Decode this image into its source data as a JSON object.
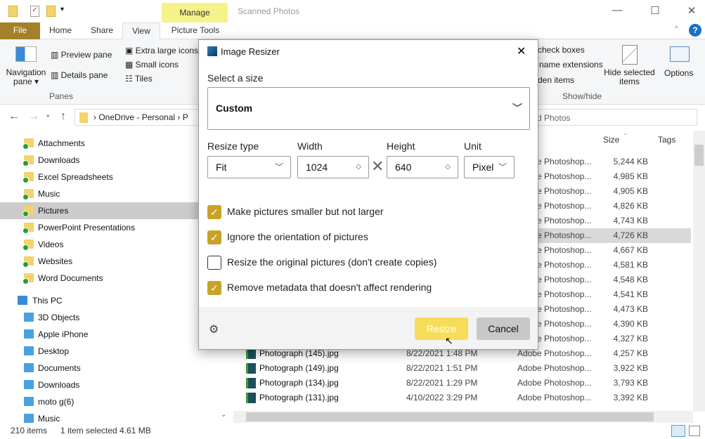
{
  "window": {
    "title": "Scanned Photos",
    "context_tab": "Manage",
    "minimize": "—",
    "maximize": "☐",
    "close": "✕"
  },
  "ribbon": {
    "tabs": [
      "File",
      "Home",
      "Share",
      "View",
      "Picture Tools"
    ],
    "navigation_pane": "Navigation pane ▾",
    "preview_pane": "Preview pane",
    "details_pane": "Details pane",
    "panes_group": "Panes",
    "layout": [
      "Extra large icons",
      "Small icons",
      "Tiles"
    ],
    "show_hide": [
      "check boxes",
      "name extensions",
      "den items"
    ],
    "hide_selected": "Hide selected items",
    "options": "Options",
    "show_hide_group": "Show/hide"
  },
  "address": {
    "path": [
      "OneDrive - Personal",
      "P"
    ],
    "search": "d Photos"
  },
  "sidebar": {
    "items": [
      {
        "label": "Attachments",
        "type": "folder"
      },
      {
        "label": "Downloads",
        "type": "folder"
      },
      {
        "label": "Excel Spreadsheets",
        "type": "folder"
      },
      {
        "label": "Music",
        "type": "folder"
      },
      {
        "label": "Pictures",
        "type": "folder",
        "selected": true
      },
      {
        "label": "PowerPoint Presentations",
        "type": "folder"
      },
      {
        "label": "Videos",
        "type": "folder"
      },
      {
        "label": "Websites",
        "type": "folder"
      },
      {
        "label": "Word Documents",
        "type": "folder"
      },
      {
        "label": "This PC",
        "type": "pc"
      },
      {
        "label": "3D Objects",
        "type": "dev"
      },
      {
        "label": "Apple iPhone",
        "type": "dev"
      },
      {
        "label": "Desktop",
        "type": "dev"
      },
      {
        "label": "Documents",
        "type": "dev"
      },
      {
        "label": "Downloads",
        "type": "dev"
      },
      {
        "label": "moto g(6)",
        "type": "dev"
      },
      {
        "label": "Music",
        "type": "dev"
      }
    ]
  },
  "files": {
    "columns": {
      "size": "Size",
      "tags": "Tags"
    },
    "rows": [
      {
        "name": "",
        "date": "",
        "type": "Adobe Photoshop...",
        "size": "5,244 KB"
      },
      {
        "name": "",
        "date": "",
        "type": "Adobe Photoshop...",
        "size": "4,985 KB"
      },
      {
        "name": "",
        "date": "",
        "type": "Adobe Photoshop...",
        "size": "4,905 KB"
      },
      {
        "name": "",
        "date": "",
        "type": "Adobe Photoshop...",
        "size": "4,826 KB"
      },
      {
        "name": "",
        "date": "",
        "type": "Adobe Photoshop...",
        "size": "4,743 KB"
      },
      {
        "name": "",
        "date": "",
        "type": "Adobe Photoshop...",
        "size": "4,726 KB",
        "selected": true
      },
      {
        "name": "",
        "date": "",
        "type": "Adobe Photoshop...",
        "size": "4,667 KB"
      },
      {
        "name": "",
        "date": "",
        "type": "Adobe Photoshop...",
        "size": "4,581 KB"
      },
      {
        "name": "",
        "date": "",
        "type": "Adobe Photoshop...",
        "size": "4,548 KB"
      },
      {
        "name": "",
        "date": "",
        "type": "Adobe Photoshop...",
        "size": "4,541 KB"
      },
      {
        "name": "",
        "date": "",
        "type": "Adobe Photoshop...",
        "size": "4,473 KB"
      },
      {
        "name": "",
        "date": "",
        "type": "Adobe Photoshop...",
        "size": "4,390 KB"
      },
      {
        "name": "",
        "date": "",
        "type": "Adobe Photoshop...",
        "size": "4,327 KB"
      },
      {
        "name": "Photograph (145).jpg",
        "date": "8/22/2021 1:48 PM",
        "type": "Adobe Photoshop...",
        "size": "4,257 KB"
      },
      {
        "name": "Photograph (149).jpg",
        "date": "8/22/2021 1:51 PM",
        "type": "Adobe Photoshop...",
        "size": "3,922 KB"
      },
      {
        "name": "Photograph (134).jpg",
        "date": "8/22/2021 1:29 PM",
        "type": "Adobe Photoshop...",
        "size": "3,793 KB"
      },
      {
        "name": "Photograph (131).jpg",
        "date": "4/10/2022 3:29 PM",
        "type": "Adobe Photoshop...",
        "size": "3,392 KB"
      }
    ]
  },
  "status": {
    "count": "210 items",
    "selection": "1 item selected  4.61 MB"
  },
  "dialog": {
    "title": "Image Resizer",
    "close": "✕",
    "select_size_label": "Select a size",
    "size_value": "Custom",
    "resize_type_label": "Resize type",
    "resize_type_value": "Fit",
    "width_label": "Width",
    "width_value": "1024",
    "height_label": "Height",
    "height_value": "640",
    "unit_label": "Unit",
    "unit_value": "Pixel",
    "options": [
      {
        "label": "Make pictures smaller but not larger",
        "checked": true
      },
      {
        "label": "Ignore the orientation of pictures",
        "checked": true
      },
      {
        "label": "Resize the original pictures (don't create copies)",
        "checked": false
      },
      {
        "label": "Remove metadata that doesn't affect rendering",
        "checked": true
      }
    ],
    "resize_button": "Resize",
    "cancel_button": "Cancel",
    "accent": "#c9a227",
    "resize_color": "#f7dc5c"
  }
}
